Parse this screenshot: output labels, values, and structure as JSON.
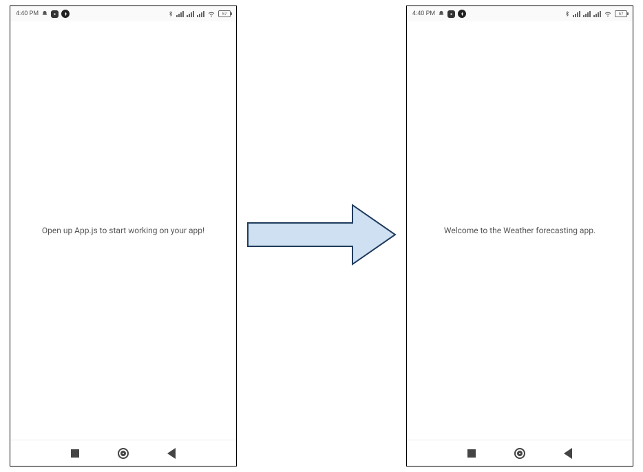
{
  "status": {
    "time": "4:40 PM",
    "battery": "57"
  },
  "screens": {
    "left_message": "Open up App.js to start working on your app!",
    "right_message": "Welcome to the Weather forecasting app."
  },
  "icons": {
    "ringer": "ringer-silent",
    "camera": "camera",
    "app": "app-badge",
    "bluetooth": "bluetooth",
    "wifi": "wifi",
    "nav_recent": "recent-apps",
    "nav_home": "home",
    "nav_back": "back"
  }
}
